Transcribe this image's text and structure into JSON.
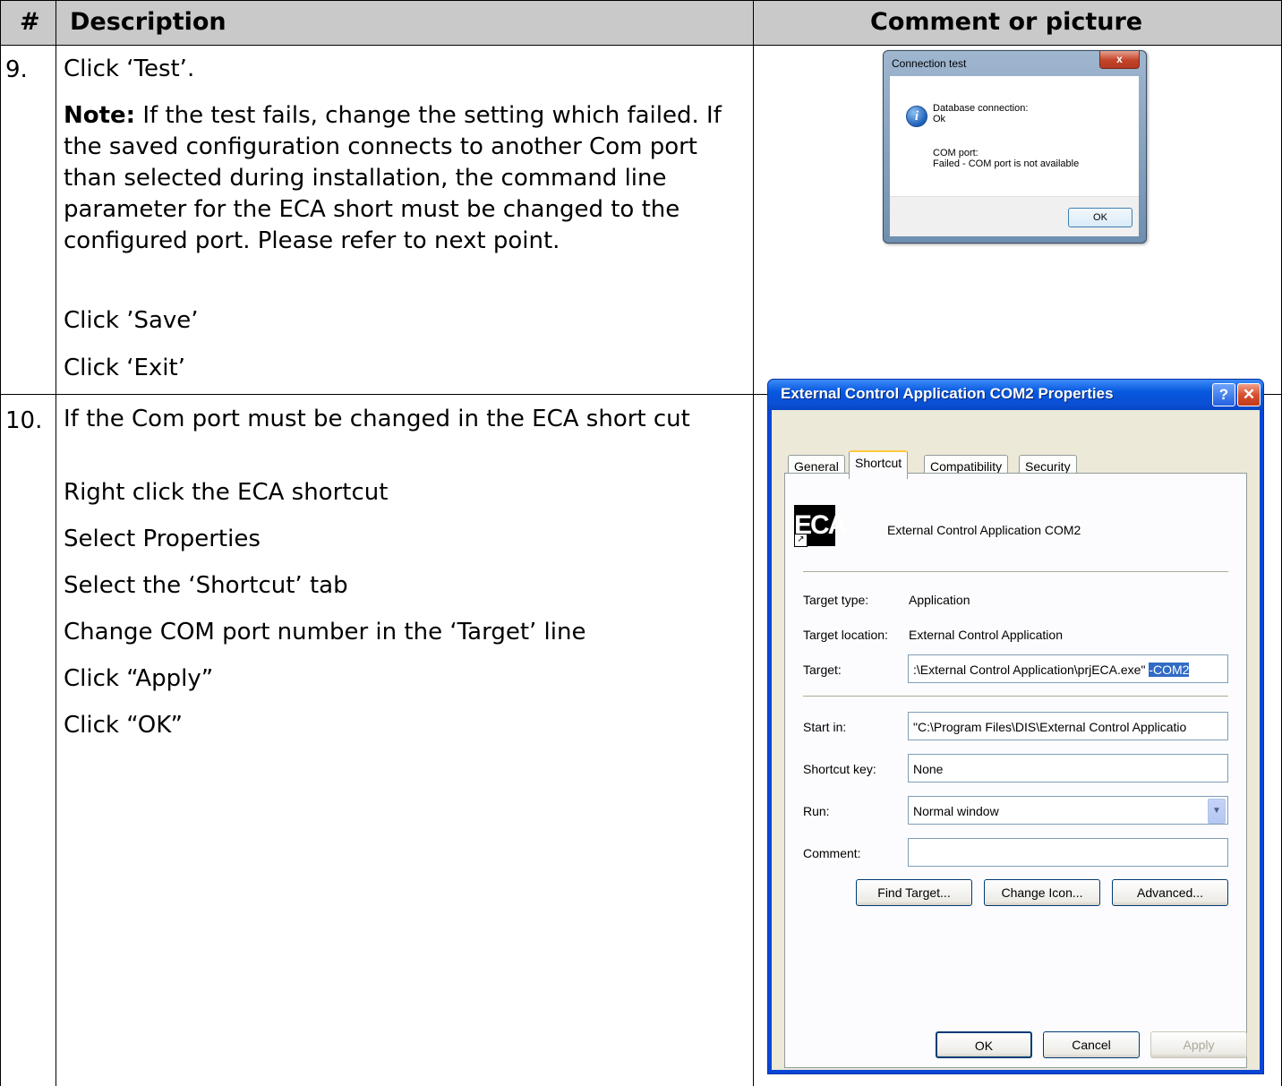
{
  "header": {
    "num": "#",
    "description": "Description",
    "comment": "Comment or picture"
  },
  "rows": [
    {
      "num": "9.",
      "lines": [
        "Click ‘Test’.",
        "Note:",
        " If the test fails, change the setting which failed. If the saved configuration connects to another Com port than selected during installation, the command line parameter for the ECA short must be changed to the configured port. Please refer to next point.",
        "Click ’Save’",
        "Click ‘Exit’"
      ]
    },
    {
      "num": "10.",
      "lines": [
        "If the Com port must be changed in the ECA short cut",
        "Right click the ECA shortcut",
        "Select Properties",
        "Select the ‘Shortcut’ tab",
        "Change COM port number in the ‘Target’ line",
        "Click “Apply”",
        "Click “OK”"
      ]
    }
  ],
  "conn_dialog": {
    "title": "Connection test",
    "close": "x",
    "icon": "info-icon",
    "line1": "Database connection:",
    "line2": "Ok",
    "line3": "COM port:",
    "line4": "Failed - COM port is not available",
    "ok": "OK"
  },
  "props_dialog": {
    "title": "External Control Application COM2 Properties",
    "help": "?",
    "close": "✕",
    "tabs": [
      "General",
      "Shortcut",
      "Compatibility",
      "Security"
    ],
    "app_icon_text": "ECA",
    "app_name": "External Control Application COM2",
    "target_type_label": "Target type:",
    "target_type_value": "Application",
    "target_location_label": "Target location:",
    "target_location_value": "External Control Application",
    "target_label": "Target:",
    "target_value": ":\\External Control Application\\prjECA.exe\" ",
    "target_selected": "-COM2",
    "start_in_label": "Start in:",
    "start_in_value": "\"C:\\Program Files\\DIS\\External Control Applicatio",
    "shortcut_key_label": "Shortcut key:",
    "shortcut_key_value": "None",
    "run_label": "Run:",
    "run_value": "Normal window",
    "comment_label": "Comment:",
    "comment_value": "",
    "find_target": "Find Target...",
    "change_icon": "Change Icon...",
    "advanced": "Advanced...",
    "ok": "OK",
    "cancel": "Cancel",
    "apply": "Apply"
  }
}
